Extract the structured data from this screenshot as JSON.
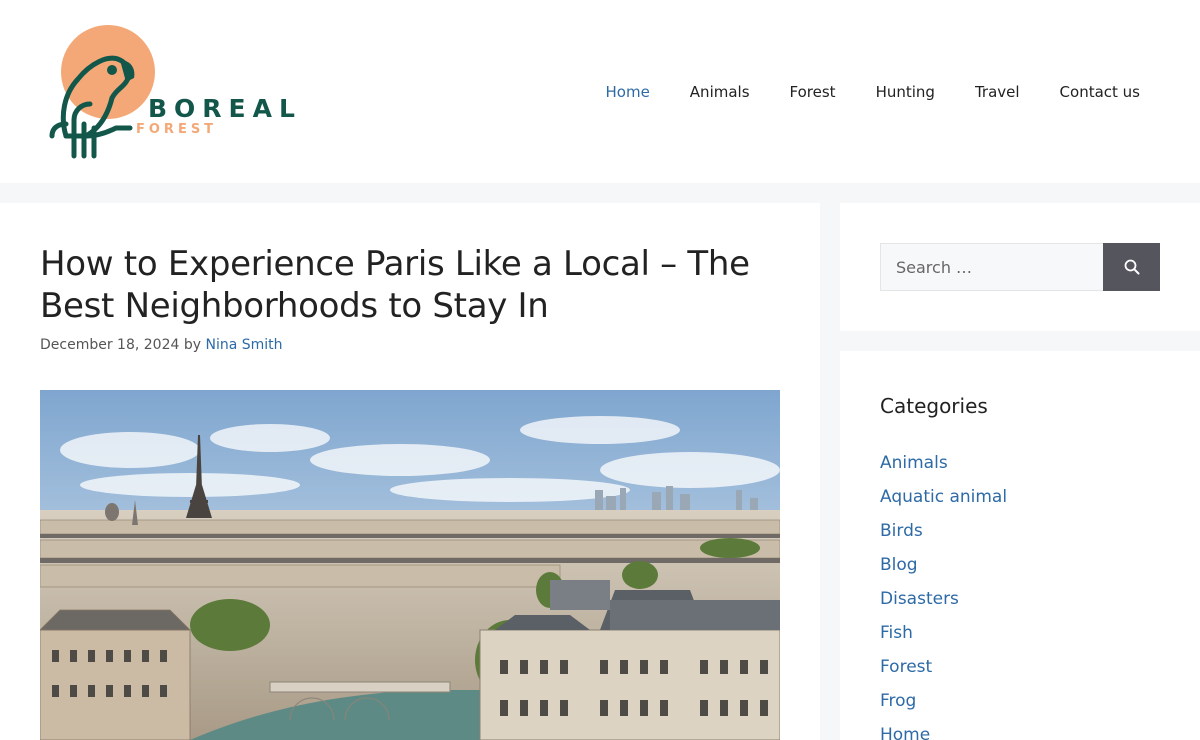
{
  "site": {
    "logo_word": "BOREAL",
    "logo_sub": "FOREST",
    "colors": {
      "brand_green": "#12574a",
      "brand_peach": "#f4a877",
      "link_blue": "#2d6aa6"
    }
  },
  "nav": [
    {
      "label": "Home",
      "active": true
    },
    {
      "label": "Animals",
      "active": false
    },
    {
      "label": "Forest",
      "active": false
    },
    {
      "label": "Hunting",
      "active": false
    },
    {
      "label": "Travel",
      "active": false
    },
    {
      "label": "Contact us",
      "active": false
    }
  ],
  "post": {
    "title": "How to Experience Paris Like a Local – The Best Neighborhoods to Stay In",
    "date": "December 18, 2024",
    "by": "by",
    "author": "Nina Smith",
    "image_subject": "Paris skyline with Eiffel Tower"
  },
  "search": {
    "placeholder": "Search …",
    "button_icon": "search-icon"
  },
  "categories": {
    "title": "Categories",
    "items": [
      "Animals",
      "Aquatic animal",
      "Birds",
      "Blog",
      "Disasters",
      "Fish",
      "Forest",
      "Frog",
      "Home"
    ]
  }
}
